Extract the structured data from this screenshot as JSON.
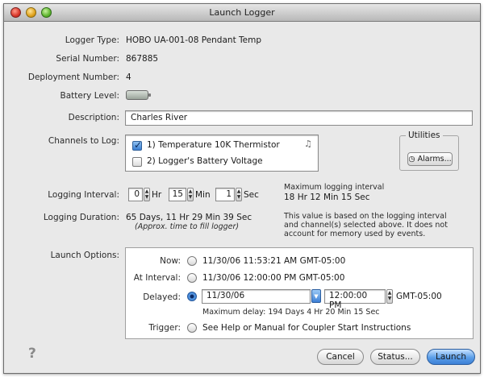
{
  "window": {
    "title": "Launch Logger"
  },
  "info": {
    "logger_type_label": "Logger Type:",
    "logger_type": "HOBO UA-001-08 Pendant Temp",
    "serial_label": "Serial Number:",
    "serial": "867885",
    "deployment_label": "Deployment Number:",
    "deployment": "4",
    "battery_label": "Battery Level:",
    "description_label": "Description:",
    "description": "Charles River"
  },
  "channels": {
    "label": "Channels to Log:",
    "items": [
      {
        "label": "1) Temperature 10K Thermistor",
        "checked": true
      },
      {
        "label": "2) Logger's Battery Voltage",
        "checked": false
      }
    ]
  },
  "utilities": {
    "label": "Utilities",
    "alarms_button": "Alarms..."
  },
  "interval": {
    "label": "Logging Interval:",
    "hr_value": "0",
    "hr_unit": "Hr",
    "min_value": "15",
    "min_unit": "Min",
    "sec_value": "1",
    "sec_unit": "Sec",
    "max_line1": "Maximum logging interval",
    "max_line2": "18 Hr 12 Min 15 Sec"
  },
  "duration": {
    "label": "Logging Duration:",
    "value": "65 Days, 11 Hr 29 Min 39 Sec",
    "note": "(Approx. time to fill logger)",
    "info1": "This value is based on the logging interval",
    "info2": "and channel(s) selected above. It does not",
    "info3": "account for memory used by events."
  },
  "launch": {
    "label": "Launch Options:",
    "now_label": "Now:",
    "now_value": "11/30/06 11:53:21 AM GMT-05:00",
    "interval_label": "At Interval:",
    "interval_value": "11/30/06 12:00:00 PM GMT-05:00",
    "delayed_label": "Delayed:",
    "delayed_date": "11/30/06",
    "delayed_time": "12:00:00 PM",
    "delayed_tz": "GMT-05:00",
    "max_delay": "Maximum delay: 194 Days 4 Hr 20 Min 15 Sec",
    "trigger_label": "Trigger:",
    "trigger_value": "See Help or Manual for Coupler Start Instructions",
    "selected": "delayed"
  },
  "buttons": {
    "cancel": "Cancel",
    "status": "Status...",
    "launch": "Launch"
  },
  "help_glyph": "?"
}
